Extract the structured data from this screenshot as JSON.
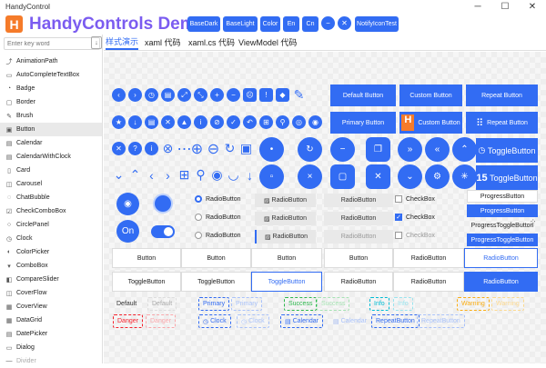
{
  "window": {
    "title": "HandyControl",
    "minimize": "─",
    "maximize": "☐",
    "close": "✕"
  },
  "header": {
    "logo_letter": "H",
    "title": "HandyControls Demo",
    "buttons": [
      "BaseDark",
      "BaseLight",
      "Color",
      "En",
      "Cn"
    ],
    "circle_minus": "−",
    "circle_close": "✕",
    "notify": "NotifyIconTest"
  },
  "sidebar": {
    "search_placeholder": "Enter key word",
    "items": [
      "AnimationPath",
      "AutoCompleteTextBox",
      "Badge",
      "Border",
      "Brush",
      "Button",
      "Calendar",
      "CalendarWithClock",
      "Card",
      "Carousel",
      "ChatBubble",
      "CheckComboBox",
      "CirclePanel",
      "Clock",
      "ColorPicker",
      "ComboBox",
      "CompareSlider",
      "CoverFlow",
      "CoverView",
      "DataGrid",
      "DatePicker",
      "Dialog",
      "Divider"
    ]
  },
  "tabs": {
    "items": [
      "样式演示",
      "xaml 代码",
      "xaml.cs 代码",
      "ViewModel 代码"
    ]
  },
  "buttons": {
    "default": "Default Button",
    "custom": "Custom Button",
    "repeat": "Repeat Button",
    "primary": "Primary Button",
    "custom2": "Custom Button",
    "repeat2": "Repeat Button",
    "toggle1": "ToggleButton",
    "toggle2": "ToggleButton",
    "on_label": "On",
    "calendar_day": "15"
  },
  "radios": {
    "radio1": "RadioButton",
    "radio2": "RadioButton",
    "radio3": "RadioButton"
  },
  "radio_buttons": {
    "r1": "RadioButton",
    "r2": "RadioButton",
    "r3": "RadioButton",
    "s1": "RadioButton",
    "s2": "RadioButton",
    "s3": "RadioButton"
  },
  "checkboxes": {
    "c1": "CheckBox",
    "c2": "CheckBox",
    "c3": "CheckBox"
  },
  "progress": {
    "p1": "ProgressButton",
    "p2": "ProgressButton",
    "p3": "ProgressToggleButton",
    "p4": "ProgressToggleButton"
  },
  "row_buttons": {
    "b1": "Button",
    "b2": "Button",
    "b3": "Button",
    "b4": "Button",
    "rb1": "RadioButton",
    "rb2": "RadioButton",
    "rb3": "RadioButton"
  },
  "row_toggles": {
    "t1": "ToggleButton",
    "t2": "ToggleButton",
    "t3": "ToggleButton",
    "t4": "ToggleButton",
    "rb1": "RadioButton",
    "rb2": "RadioButton",
    "rb3": "RadioButton"
  },
  "tags": {
    "default": "Default",
    "default2": "Default",
    "primary": "Primary",
    "primary2": "Primary",
    "success": "Success",
    "success2": "Success",
    "info": "Info",
    "info2": "Info",
    "warning": "Warning",
    "warning2": "Warning",
    "danger": "Danger",
    "danger2": "Danger",
    "clock": "Clock",
    "clock2": "Clock",
    "calendar": "Calendar",
    "calendar2": "Calendar",
    "repeat": "RepeatButton",
    "repeat2": "RepeatButton"
  },
  "colors": {
    "accent": "#326cf3",
    "logo": "#f57b2a",
    "title": "#7b5cf0",
    "success": "#2db84d",
    "info": "#00bcd4",
    "warning": "#faad14",
    "danger": "#f5222d"
  }
}
